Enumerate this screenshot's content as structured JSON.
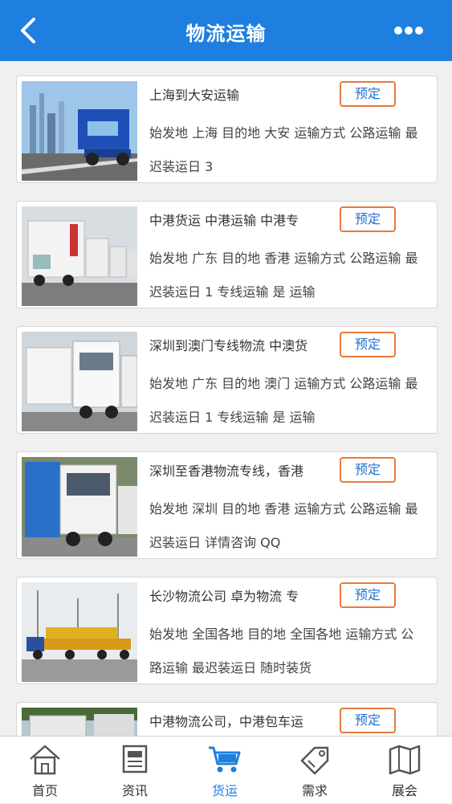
{
  "header": {
    "title": "物流运输"
  },
  "colors": {
    "header_bg": "#1f7fe0",
    "button_border": "#e87a3a",
    "button_text": "#1f6fd0",
    "active_nav": "#1f7fe0"
  },
  "items": [
    {
      "title": "上海到大安运输",
      "desc": "始发地 上海 目的地 大安 运输方式 公路运输 最迟装运日 3",
      "button": "预定",
      "image": "blue truck on highway"
    },
    {
      "title": "中港货运 中港运输 中港专",
      "desc": "始发地 广东 目的地 香港 运输方式 公路运输 最迟装运日 1 专线运输 是 运输",
      "button": "预定",
      "image": "white trucks in a row"
    },
    {
      "title": "深圳到澳门专线物流 中澳货",
      "desc": "始发地 广东 目的地 澳门 运输方式 公路运输 最迟装运日 1 专线运输 是 运输",
      "button": "预定",
      "image": "white container truck"
    },
    {
      "title": "深圳至香港物流专线，香港",
      "desc": "始发地 深圳 目的地 香港 运输方式 公路运输 最迟装运日 详情咨询 QQ",
      "button": "预定",
      "image": "blue container truck"
    },
    {
      "title": "长沙物流公司 卓为物流 专",
      "desc": "始发地 全国各地 目的地 全国各地 运输方式 公路运输 最迟装运日 随时装货",
      "button": "预定",
      "image": "heavy machinery transport"
    },
    {
      "title": "中港物流公司，中港包车运",
      "desc": "",
      "button": "预定",
      "image": "truck at port"
    }
  ],
  "nav": [
    {
      "label": "首页",
      "icon": "home-icon"
    },
    {
      "label": "资讯",
      "icon": "news-icon"
    },
    {
      "label": "货运",
      "icon": "cart-icon",
      "active": true
    },
    {
      "label": "需求",
      "icon": "tag-icon"
    },
    {
      "label": "展会",
      "icon": "map-icon"
    }
  ]
}
